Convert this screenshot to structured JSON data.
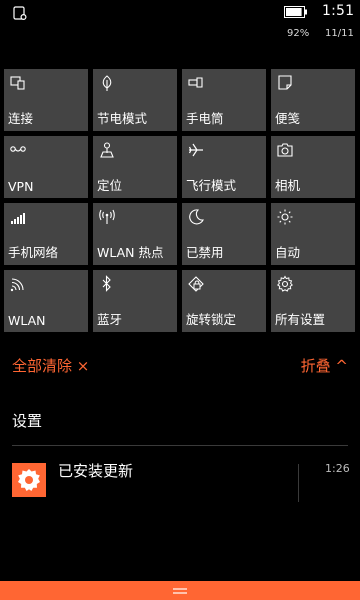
{
  "status_bar": {
    "time": "1:51",
    "battery_percent": "92%",
    "date": "11/11",
    "battery_level": 0.92
  },
  "quick_actions": [
    {
      "label": "连接",
      "icon": "connect-icon"
    },
    {
      "label": "节电模式",
      "icon": "battery-saver-icon"
    },
    {
      "label": "手电筒",
      "icon": "flashlight-icon"
    },
    {
      "label": "便笺",
      "icon": "note-icon"
    },
    {
      "label": "VPN",
      "icon": "vpn-icon"
    },
    {
      "label": "定位",
      "icon": "location-icon"
    },
    {
      "label": "飞行模式",
      "icon": "airplane-icon"
    },
    {
      "label": "相机",
      "icon": "camera-icon"
    },
    {
      "label": "手机网络",
      "icon": "cellular-icon"
    },
    {
      "label": "WLAN 热点",
      "icon": "hotspot-icon"
    },
    {
      "label": "已禁用",
      "icon": "moon-icon"
    },
    {
      "label": "自动",
      "icon": "brightness-icon"
    },
    {
      "label": "WLAN",
      "icon": "wifi-icon"
    },
    {
      "label": "蓝牙",
      "icon": "bluetooth-icon"
    },
    {
      "label": "旋转锁定",
      "icon": "rotation-lock-icon"
    },
    {
      "label": "所有设置",
      "icon": "settings-icon"
    }
  ],
  "actions": {
    "clear_all": "全部清除 ×",
    "collapse": "折叠 ^"
  },
  "notifications": {
    "section_title": "设置",
    "items": [
      {
        "title": "已安装更新",
        "time": "1:26",
        "icon": "gear-icon"
      }
    ]
  },
  "colors": {
    "accent": "#ff6633",
    "tile": "#444444",
    "background": "#000000"
  }
}
